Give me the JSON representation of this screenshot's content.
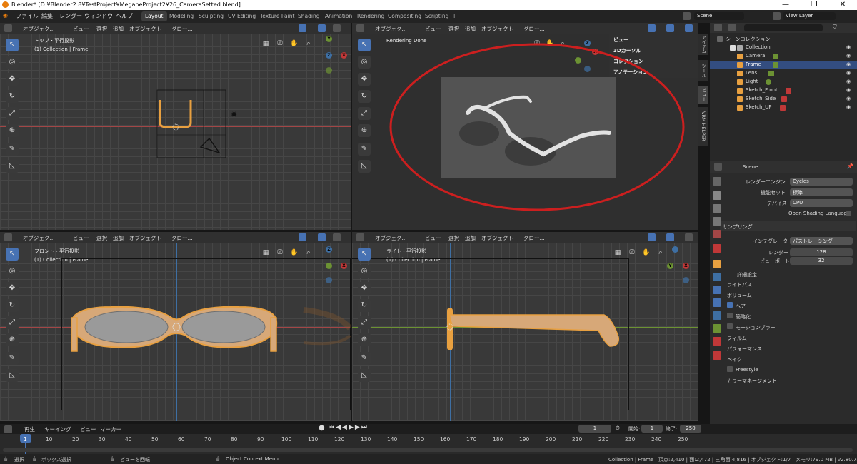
{
  "window": {
    "title": "Blender* [D:¥Blender2.8¥TestProject¥MeganeProject2¥26_CameraSetted.blend]",
    "min": "—",
    "max": "❐",
    "close": "✕"
  },
  "menus": [
    "ファイル",
    "編集",
    "レンダー",
    "ウィンドウ",
    "ヘルプ"
  ],
  "workspaces": [
    "Layout",
    "Modeling",
    "Sculpting",
    "UV Editing",
    "Texture Paint",
    "Shading",
    "Animation",
    "Rendering",
    "Compositing",
    "Scripting",
    "+"
  ],
  "scene_field": "Scene",
  "viewlayer_field": "View Layer",
  "viewport_header": {
    "items": [
      "ビュー",
      "選択",
      "追加",
      "オブジェクト"
    ],
    "mode": "オブジェク...",
    "orient": "グロー..."
  },
  "viewports": {
    "top": {
      "line1": "トップ・平行投影",
      "line2": "(1) Collection | Frame"
    },
    "render": {
      "line1": "Rendering Done"
    },
    "front": {
      "line1": "フロント・平行投影",
      "line2": "(1) Collection | Frame"
    },
    "right": {
      "line1": "ライト・平行投影",
      "line2": "(1) Collection | Frame"
    }
  },
  "gizmo": {
    "x": "X",
    "y": "Y",
    "z": "Z"
  },
  "npanel": [
    "ビュー",
    "3Dカーソル",
    "コレクション",
    "アノテーション"
  ],
  "side_tabs": [
    "アイテム",
    "ツール",
    "ビュー",
    "VRM HELPER"
  ],
  "outliner": {
    "root": "シーンコレクション",
    "collection": "Collection",
    "items": [
      "Camera",
      "Frame",
      "Lens",
      "Light",
      "Sketch_Front",
      "Sketch_Side",
      "Sketch_UP"
    ]
  },
  "properties": {
    "scene": "Scene",
    "render_engine_label": "レンダーエンジン",
    "render_engine": "Cycles",
    "feature_set_label": "機能セット",
    "feature_set": "標準",
    "device_label": "デバイス",
    "device": "CPU",
    "osl": "Open Shading Language",
    "sampling": "サンプリング",
    "integrator_label": "インテグレータ",
    "integrator": "パストレーシング",
    "render_label": "レンダー",
    "render_samples": "128",
    "viewport_label": "ビューポート",
    "viewport_samples": "32",
    "advanced": "詳細設定",
    "sections": [
      "ライトパス",
      "ボリューム",
      "ヘアー",
      "簡略化",
      "モーションブラー",
      "フィルム",
      "パフォーマンス",
      "ベイク",
      "Freestyle",
      "カラーマネージメント"
    ]
  },
  "timeline": {
    "menu": [
      "再生",
      "キーイング",
      "ビュー",
      "マーカー"
    ],
    "current_frame": "1",
    "start_label": "開始:",
    "start": "1",
    "end_label": "終了:",
    "end": "250",
    "ticks": [
      "1",
      "10",
      "20",
      "30",
      "40",
      "50",
      "60",
      "70",
      "80",
      "90",
      "100",
      "110",
      "120",
      "130",
      "140",
      "150",
      "160",
      "170",
      "180",
      "190",
      "200",
      "210",
      "220",
      "230",
      "240",
      "250"
    ]
  },
  "status": {
    "select": "選択",
    "box_select": "ボックス選択",
    "rotate": "ビューを回転",
    "context": "Object Context Menu",
    "stats": "Collection | Frame | 頂点:2,410 | 面:2,472 | 三角面:4,816 | オブジェクト:1/7 | メモリ:79.0 MB | v2.80.75"
  },
  "colors": {
    "accent": "#4772b3",
    "selected_orange": "#e8a040",
    "render_circle": "#cc1f1f"
  }
}
